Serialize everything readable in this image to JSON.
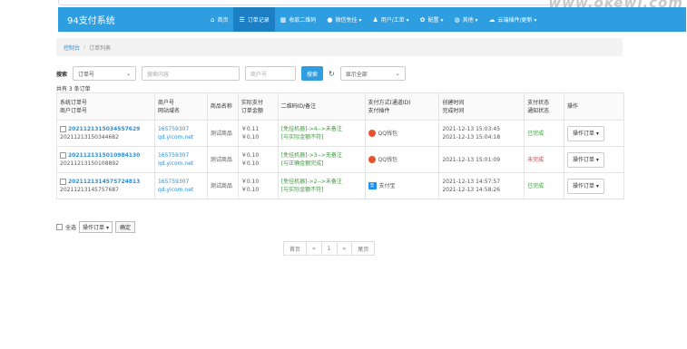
{
  "watermark": "www.okewl.com",
  "navbar": {
    "brand": "94支付系统",
    "items": [
      {
        "icon": "home-icon",
        "glyph": "⌂",
        "label": "首页",
        "active": false
      },
      {
        "icon": "list-icon",
        "glyph": "☰",
        "label": "订单记录",
        "active": true
      },
      {
        "icon": "qrcode-icon",
        "glyph": "▦",
        "label": "收款二维码",
        "active": false
      },
      {
        "icon": "chat-icon",
        "glyph": "●",
        "label": "微信免挂 ▾",
        "active": false
      },
      {
        "icon": "user-icon",
        "glyph": "♟",
        "label": "用户/工单 ▾",
        "active": false
      },
      {
        "icon": "gear-icon",
        "glyph": "✿",
        "label": "配置 ▾",
        "active": false
      },
      {
        "icon": "globe-icon",
        "glyph": "◍",
        "label": "其他 ▾",
        "active": false
      },
      {
        "icon": "cloud-icon",
        "glyph": "☁",
        "label": "云端插件/更新 ▾",
        "active": false
      }
    ]
  },
  "breadcrumb": {
    "home": "控制台",
    "sep": "/",
    "current": "订单列表"
  },
  "search": {
    "label": "搜索",
    "field_value": "订单号",
    "content_placeholder": "搜索内容",
    "merchant_placeholder": "商户号",
    "button": "搜索",
    "refresh_glyph": "↻",
    "display_value": "显示全部"
  },
  "count_text": "共有 3 条订单",
  "table": {
    "headers": [
      [
        "系统订单号",
        "商户订单号"
      ],
      [
        "商户号",
        "网站域名"
      ],
      [
        "商品名称",
        ""
      ],
      [
        "实际支付",
        "订单金额"
      ],
      [
        "二维码ID/备注",
        ""
      ],
      [
        "支付方式(通道ID)",
        "支付插件"
      ],
      [
        "创建时间",
        "完成时间"
      ],
      [
        "支付状态",
        "通知状态"
      ],
      [
        "操作",
        ""
      ]
    ],
    "rows": [
      {
        "sys_id": "2021121315034557629",
        "merchant_order": "20211213150344682",
        "uid": "165759307",
        "domain": "qd.yicom.net",
        "product": "测试商品",
        "paid": "￥0.11",
        "amount": "￥0.10",
        "remark1": "[免挂机器]->4-->未备注",
        "remark2": "[与实际金额不符]",
        "pay_icon": "qq",
        "pay_label": "QQ钱包",
        "created": "2021-12-13 15:03:45",
        "finished": "2021-12-13 15:04:18",
        "status": "已完成",
        "status_class": "status-done",
        "op": "操作订单 ▾"
      },
      {
        "sys_id": "2021121315010984130",
        "merchant_order": "20211213150108892",
        "uid": "165759307",
        "domain": "qd.yicom.net",
        "product": "测试商品",
        "paid": "￥0.10",
        "amount": "￥0.10",
        "remark1": "[免挂机器]->3-->无备注",
        "remark2": "[与正确金额完成]",
        "pay_icon": "qq",
        "pay_label": "QQ钱包",
        "created": "2021-12-13 15:01:09",
        "finished": "",
        "status": "未完成",
        "status_class": "status-pending",
        "op": "操作订单 ▾"
      },
      {
        "sys_id": "2021121314575724813",
        "merchant_order": "20211213145757687",
        "uid": "165759307",
        "domain": "qd.yicom.net",
        "product": "测试商品",
        "paid": "￥0.10",
        "amount": "￥0.10",
        "remark1": "[免挂机器]->2-->未备注",
        "remark2": "[与实际金额不符]",
        "pay_icon": "ali",
        "pay_label": "支付宝",
        "created": "2021-12-13 14:57:57",
        "finished": "2021-12-13 14:58:26",
        "status": "已完成",
        "status_class": "status-done",
        "op": "操作订单 ▾"
      }
    ]
  },
  "bulk": {
    "select_all": "全选",
    "action": "操作订单",
    "confirm": "确定"
  },
  "pager": [
    "首页",
    "«",
    "1",
    "»",
    "尾页"
  ]
}
